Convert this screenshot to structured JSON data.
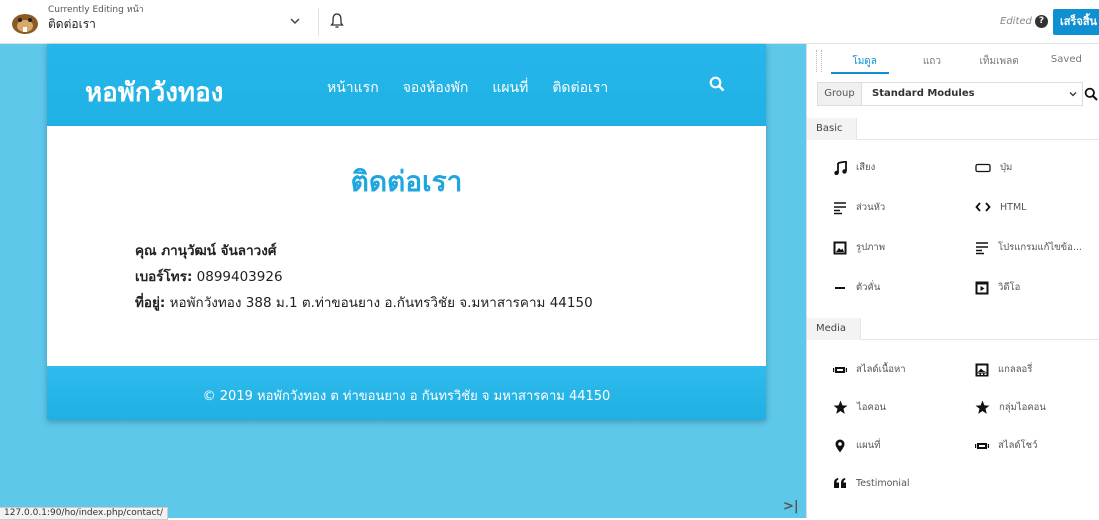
{
  "topbar": {
    "editing_label": "Currently Editing หน้า",
    "page_name": "ติดต่อเรา",
    "edited_label": "Edited",
    "help_icon": "?",
    "done_label": "เสร็จสิ้น"
  },
  "site": {
    "brand": "หอพักวังทอง",
    "nav": [
      "หน้าแรก",
      "จองห้องพัก",
      "แผนที่",
      "ติดต่อเรา"
    ],
    "heading": "ติดต่อเรา",
    "contact_name": "คุณ ภานุวัฒน์ จันลาวงศ์",
    "phone_label": "เบอร์โทร:",
    "phone_value": "0899403926",
    "address_label": "ที่อยู่:",
    "address_value": "หอพักวังทอง  388 ม.1 ต.ท่าขอนยาง อ.กันทรวิชัย จ.มหาสารคาม 44150",
    "footer": "© 2019 หอพักวังทอง ต ท่าขอนยาง อ กันทรวิชัย จ มหาสารคาม 44150"
  },
  "statusbar": {
    "url": "127.0.0.1:90/ho/index.php/contact/"
  },
  "panel": {
    "tabs": [
      "โมดูล",
      "แถว",
      "เท็มเพลต",
      "Saved"
    ],
    "group_label": "Group",
    "group_value": "Standard Modules",
    "basic_title": "Basic",
    "basic_modules": [
      {
        "label": "เสียง",
        "icon": "music-note-icon"
      },
      {
        "label": "ปุ่ม",
        "icon": "button-icon"
      },
      {
        "label": "ส่วนหัว",
        "icon": "heading-icon"
      },
      {
        "label": "HTML",
        "icon": "code-icon"
      },
      {
        "label": "รูปภาพ",
        "icon": "image-icon"
      },
      {
        "label": "โปรแกรมแก้ไขข้อ...",
        "icon": "text-editor-icon"
      },
      {
        "label": "ตัวคั่น",
        "icon": "separator-icon"
      },
      {
        "label": "วิดีโอ",
        "icon": "video-icon"
      }
    ],
    "media_title": "Media",
    "media_modules": [
      {
        "label": "สไลด์เนื้อหา",
        "icon": "content-slider-icon"
      },
      {
        "label": "แกลลอรี่",
        "icon": "gallery-icon"
      },
      {
        "label": "ไอคอน",
        "icon": "star-icon"
      },
      {
        "label": "กลุ่มไอคอน",
        "icon": "icon-group-icon"
      },
      {
        "label": "แผนที่",
        "icon": "map-pin-icon"
      },
      {
        "label": "สไลด์โชว์",
        "icon": "slideshow-icon"
      },
      {
        "label": "Testimonial",
        "icon": "quote-icon"
      }
    ]
  }
}
